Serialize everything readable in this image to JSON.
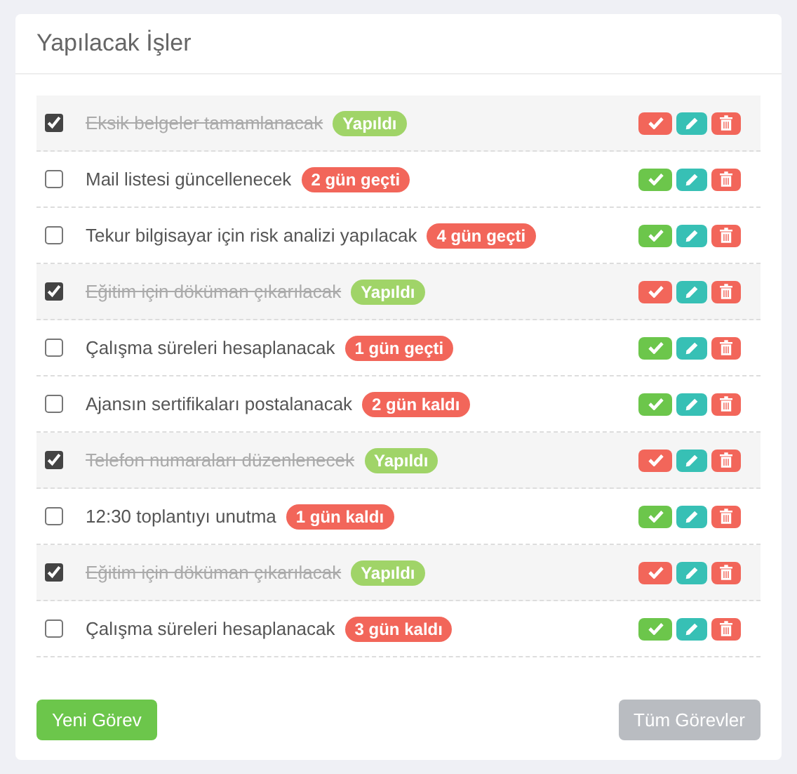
{
  "title": "Yapılacak İşler",
  "tasks": [
    {
      "text": "Eksik belgeler tamamlanacak",
      "checked": true,
      "badge": "Yapıldı",
      "color": "#a0d468"
    },
    {
      "text": "Mail listesi güncellenecek",
      "checked": false,
      "badge": "2 gün geçti",
      "color": "#f2665a"
    },
    {
      "text": "Tekur bilgisayar için risk analizi yapılacak",
      "checked": false,
      "badge": "4 gün geçti",
      "color": "#f2665a"
    },
    {
      "text": "Eğitim için döküman çıkarılacak",
      "checked": true,
      "badge": "Yapıldı",
      "color": "#a0d468"
    },
    {
      "text": "Çalışma süreleri hesaplanacak",
      "checked": false,
      "badge": "1 gün geçti",
      "color": "#f2665a"
    },
    {
      "text": "Ajansın sertifikaları postalanacak",
      "checked": false,
      "badge": "2 gün kaldı",
      "color": "#f2665a"
    },
    {
      "text": "Telefon numaraları düzenlenecek",
      "checked": true,
      "badge": "Yapıldı",
      "color": "#a0d468"
    },
    {
      "text": "12:30 toplantıyı unutma",
      "checked": false,
      "badge": "1 gün kaldı",
      "color": "#f2665a"
    },
    {
      "text": "Eğitim için döküman çıkarılacak",
      "checked": true,
      "badge": "Yapıldı",
      "color": "#a0d468"
    },
    {
      "text": "Çalışma süreleri hesaplanacak",
      "checked": false,
      "badge": "3 gün kaldı",
      "color": "#f2665a"
    }
  ],
  "buttons": {
    "new": "Yeni Görev",
    "all": "Tüm Görevler"
  }
}
